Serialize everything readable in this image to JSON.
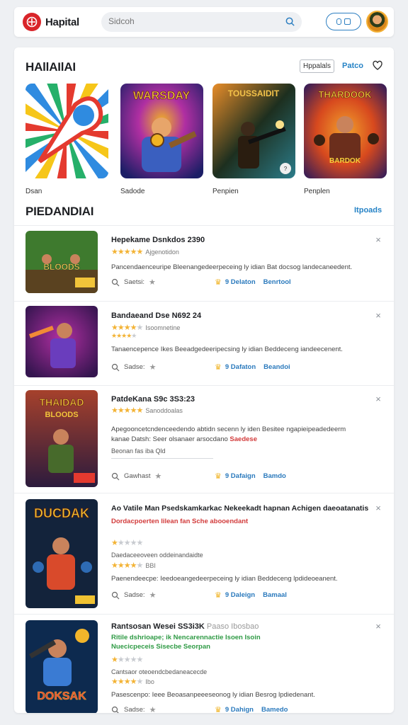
{
  "header": {
    "app_title": "Hapital",
    "search_placeholder": "Sidcoh",
    "icons": {
      "logo": "logo-icon",
      "search": "search-icon",
      "pill": "dual-icon-button",
      "avatar": "avatar"
    }
  },
  "featured": {
    "title": "HAllAIlAI",
    "chip_label": "Hppalals",
    "link_label": "Patco",
    "cards": [
      {
        "label": "Dsan",
        "colors": [
          "#e43a2f",
          "#f6c619",
          "#2f8be0",
          "#26b06a"
        ]
      },
      {
        "label": "Sadode",
        "colors": [
          "#6a2fb4",
          "#e05d2a",
          "#1c1e66",
          "#f0b323"
        ]
      },
      {
        "label": "Penpien",
        "colors": [
          "#1d2f1f",
          "#e88d2a",
          "#2b7c8a",
          "#3d2a1a"
        ]
      },
      {
        "label": "Penplen",
        "colors": [
          "#2d1a5a",
          "#d7491e",
          "#f2a22c",
          "#6b2e1c"
        ]
      }
    ]
  },
  "recent": {
    "title": "PIEDANDIAI",
    "link_label": "Itpoads",
    "items": [
      {
        "title": "Hepekame Dsnkdos 2390",
        "rating": 5,
        "rating_label": "Ajgenotidon",
        "desc": "Pancendaenceuripe Bleenangedeerpeceing ly idian Bat docsog landecaneedent.",
        "meta": "Saetsi:",
        "action": "9 Delaton",
        "action2": "Benrtool",
        "thumb_colors": [
          "#3e7a2e",
          "#b6842b",
          "#2b3f70",
          "#e45c2b"
        ]
      },
      {
        "title": "Bandaeand Dse N692 24",
        "rating": 4,
        "rating_label": "Isoomnetine",
        "desc": "Tanaencepence Ikes Beeadgedeeripecsing ly idian Beddeceng iandeecenent.",
        "meta": "Sadse:",
        "action": "9 Dafaton",
        "action2": "Beandoi",
        "thumb_colors": [
          "#35154f",
          "#b02fa2",
          "#f08a36",
          "#6a3dbd"
        ]
      },
      {
        "title": "PatdeKana S9c 3S3:23",
        "rating": 5,
        "rating_label": "Sanoddoalas",
        "desc": "Apegooncetcndenceedendo abtidn secenn ly iden Besitee ngapieipeadedeerm",
        "desc2": "kanae Datsh: Seer olsanaer arsocdano",
        "desc2_red": "Saedese",
        "sub": "Beonan fas iba  Qld",
        "meta": "Gawhast",
        "action": "9 Dafaign",
        "action2": "Bamdo",
        "thumb_colors": [
          "#a6412c",
          "#f1c43a",
          "#476a2b",
          "#2c1b3d"
        ]
      },
      {
        "title": "Ao Vatile Man Psedskamkarkac Nekeekadt hapnan Achigen daeoatanatis",
        "rating": 1,
        "rating_label": "",
        "desc_red": "Dordacpoerten lilean fan Sche abooendant",
        "sub": "Daedaceeoveen oddeinandaidte",
        "rating2": 4,
        "rating2_label": "BBI",
        "desc": "Paenendeecpe: Ieedoeangedeerpeceing ly idian Beddeceng lpdideoeanent.",
        "meta": "Sadse:",
        "action": "9 Daleign",
        "action2": "Bamaal",
        "thumb_colors": [
          "#13233b",
          "#d94a2b",
          "#f0c232",
          "#2e6bb4"
        ]
      },
      {
        "title": "Rantsosan Wesei SS3i3K",
        "title_faint": "Paaso Ibosbao",
        "desc_green": "Ritile dshrioape; ik Nencarennactie Isoen Isoin",
        "desc_green2": "Nuecicpeceis Sisecbe Seorpan",
        "rating": 1,
        "rating_label": "",
        "sub": "Cantsaor oteoendcbedaneacecde",
        "rating2": 4,
        "rating2_label": "Ibo",
        "desc": "Pasescenpo: Ieee Beoasanpeeeseonog ly idian Besrog lpdiedenant.",
        "meta": "Sadse:",
        "action": "9 Dahign",
        "action2": "Bamedo",
        "thumb_colors": [
          "#0d2a4f",
          "#e1433b",
          "#f2b52b",
          "#3a7bd3"
        ]
      }
    ]
  }
}
